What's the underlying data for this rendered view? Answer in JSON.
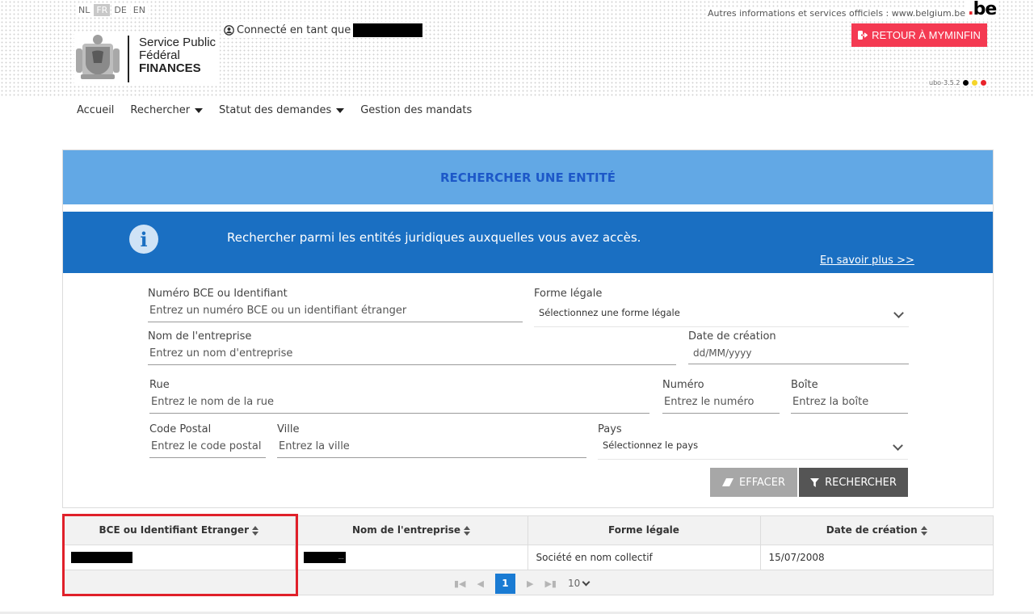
{
  "header": {
    "languages": [
      "NL",
      "FR",
      "DE",
      "EN"
    ],
    "active_language": "FR",
    "official_info": "Autres informations et services officiels : www.belgium.be",
    "be_logo": "be",
    "connected_as": "Connecté en tant que",
    "myminfin_label": "RETOUR À MYMINFIN",
    "logo_line1": "Service Public",
    "logo_line2": "Fédéral",
    "logo_line3": "FINANCES",
    "version": "ubo-3.5.2",
    "flag_colors": [
      "#000000",
      "#f5d52a",
      "#e8232a"
    ]
  },
  "nav": {
    "home": "Accueil",
    "search": "Rechercher",
    "status": "Statut des demandes",
    "mandates": "Gestion des mandats"
  },
  "search_panel": {
    "title": "RECHERCHER UNE ENTITÉ",
    "info_text": "Rechercher parmi les entités juridiques auxquelles vous avez accès.",
    "learn_more": "En savoir plus >>",
    "fields": {
      "bce_label": "Numéro BCE ou Identifiant",
      "bce_placeholder": "Entrez un numéro BCE ou un identifiant étranger",
      "legal_form_label": "Forme légale",
      "legal_form_value": "Sélectionnez une forme légale",
      "company_label": "Nom de l'entreprise",
      "company_placeholder": "Entrez un nom d'entreprise",
      "date_label": "Date de création",
      "date_placeholder": "dd/MM/yyyy",
      "street_label": "Rue",
      "street_placeholder": "Entrez le nom de la rue",
      "number_label": "Numéro",
      "number_placeholder": "Entrez le numéro",
      "box_label": "Boîte",
      "box_placeholder": "Entrez la boîte",
      "postal_label": "Code Postal",
      "postal_placeholder": "Entrez le code postal",
      "city_label": "Ville",
      "city_placeholder": "Entrez la ville",
      "country_label": "Pays",
      "country_value": "Sélectionnez le pays"
    },
    "clear_label": "EFFACER",
    "search_label": "RECHERCHER"
  },
  "results": {
    "columns": [
      "BCE ou Identifiant Etranger",
      "Nom de l'entreprise",
      "Forme légale",
      "Date de création"
    ],
    "rows": [
      {
        "bce": "",
        "name": "...",
        "legal_form": "Société en nom collectif",
        "date": "15/07/2008"
      }
    ],
    "current_page": "1",
    "per_page": "10"
  }
}
